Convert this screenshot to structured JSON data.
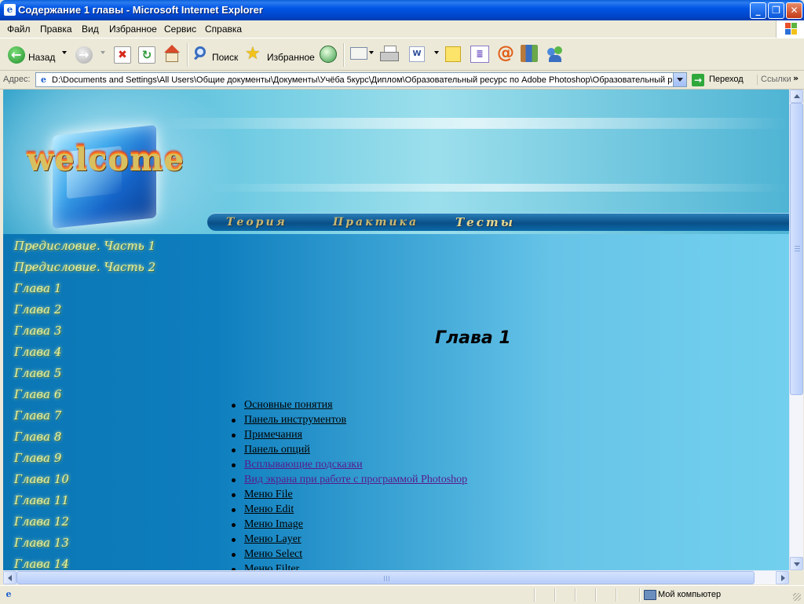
{
  "window": {
    "title": "Содержание 1 главы - Microsoft Internet Explorer",
    "controls": {
      "minimize": "_",
      "maximize": "❐",
      "close": "✕"
    }
  },
  "menu": [
    "Файл",
    "Правка",
    "Вид",
    "Избранное",
    "Сервис",
    "Справка"
  ],
  "toolbar": {
    "back_label": "Назад",
    "search_label": "Поиск",
    "favorites_label": "Избранное"
  },
  "address": {
    "label": "Адрес:",
    "url": "D:\\Documents and Settings\\All Users\\Общие документы\\Документы\\Учёба 5курс\\Диплом\\Образовательный ресурс по Adobe Photoshop\\Образовательный р",
    "go_label": "Переход",
    "links_label": "Ссылки",
    "links_chevron": "»"
  },
  "banner": {
    "logo_text": "welcome",
    "nav": [
      "Теория",
      "Практика",
      "Тесты"
    ]
  },
  "sidebar": {
    "items": [
      "Предисловие. Часть 1",
      "Предисловие. Часть 2",
      "Глава 1",
      "Глава 2",
      "Глава 3",
      "Глава 4",
      "Глава 5",
      "Глава 6",
      "Глава 7",
      "Глава 8",
      "Глава 9",
      "Глава 10",
      "Глава 11",
      "Глава 12",
      "Глава 13",
      "Глава 14"
    ]
  },
  "main": {
    "title": "Глава 1",
    "toc": [
      {
        "label": "Основные понятия",
        "visited": false
      },
      {
        "label": "Панель инструментов",
        "visited": false
      },
      {
        "label": "Примечания",
        "visited": false
      },
      {
        "label": "Панель опций",
        "visited": false
      },
      {
        "label": "Всплывающие подсказки",
        "visited": true
      },
      {
        "label": "Вид экрана при работе с программой Photoshop",
        "visited": true
      },
      {
        "label": "Меню File",
        "visited": false
      },
      {
        "label": "Меню Edit",
        "visited": false
      },
      {
        "label": "Меню Image",
        "visited": false
      },
      {
        "label": "Меню Layer",
        "visited": false
      },
      {
        "label": "Меню Select",
        "visited": false
      },
      {
        "label": "Меню Filter",
        "visited": false
      }
    ]
  },
  "status": {
    "zone_label": "Мой компьютер"
  },
  "colors": {
    "link": "#000000",
    "visited_link": "#551A8B",
    "sidebar_text": "#EAF29A",
    "nav_text": "#C8B870"
  }
}
